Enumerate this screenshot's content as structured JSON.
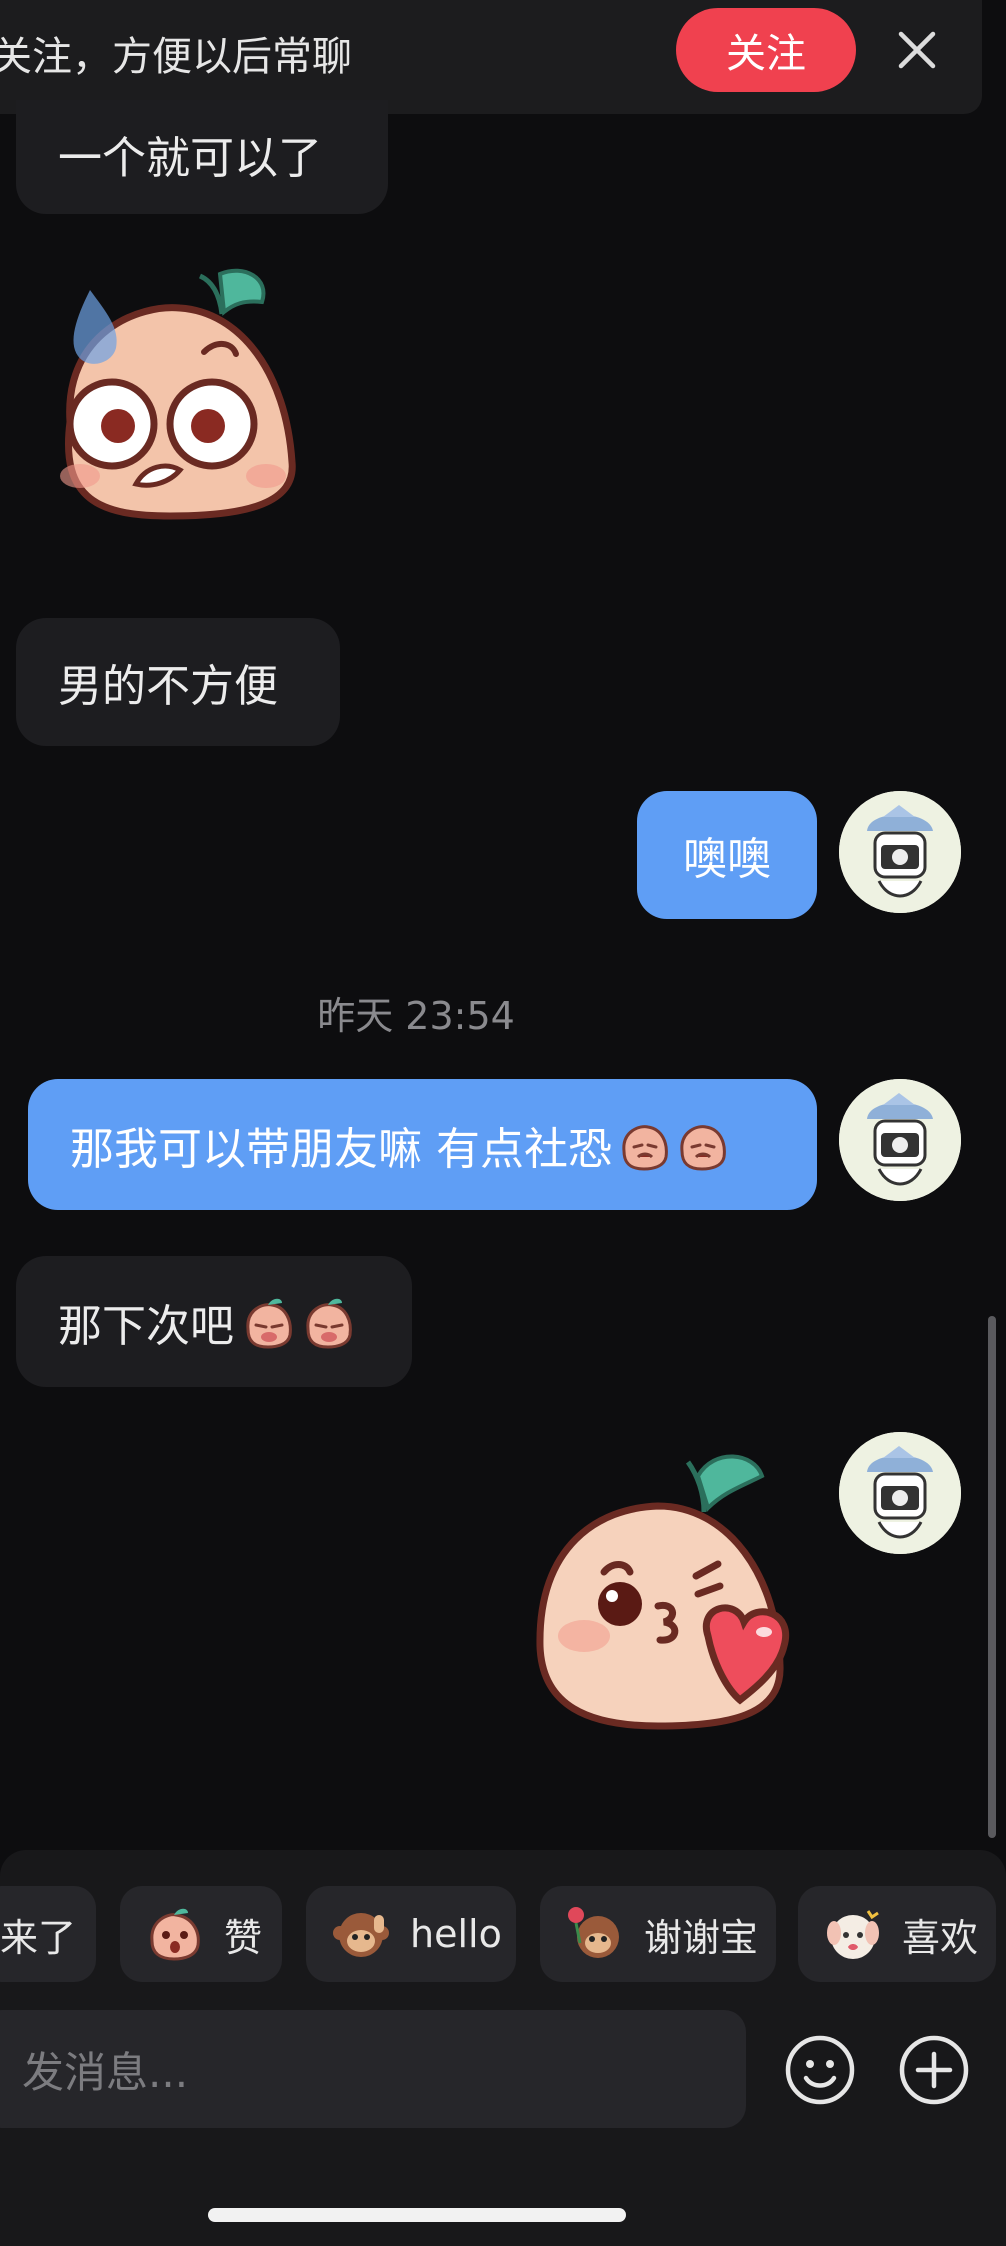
{
  "follow_banner": {
    "text": "关注，方便以后常聊",
    "follow_button": "关注",
    "close_icon": "close-icon"
  },
  "messages": {
    "m1": "一个就可以了",
    "m2": "男的不方便",
    "m3": "噢噢",
    "timestamp": "昨天 23:54",
    "m4": "那我可以带朋友嘛 有点社恐",
    "m5": "那下次吧"
  },
  "quick_replies": [
    {
      "label": "来了",
      "icon": "peach-emoji-icon"
    },
    {
      "label": "赞",
      "icon": "peach-surprised-icon"
    },
    {
      "label": "hello",
      "icon": "monkey-wave-icon"
    },
    {
      "label": "谢谢宝",
      "icon": "monkey-flower-icon"
    },
    {
      "label": "喜欢",
      "icon": "dog-heart-icon"
    }
  ],
  "composer": {
    "placeholder": "发消息...",
    "emoji_icon": "smiley-icon",
    "plus_icon": "plus-circle-icon"
  },
  "colors": {
    "background": "#0d0d0f",
    "incoming_bubble": "#1d1d20",
    "outgoing_bubble": "#5f9ef5",
    "follow_button": "#f0414f"
  }
}
